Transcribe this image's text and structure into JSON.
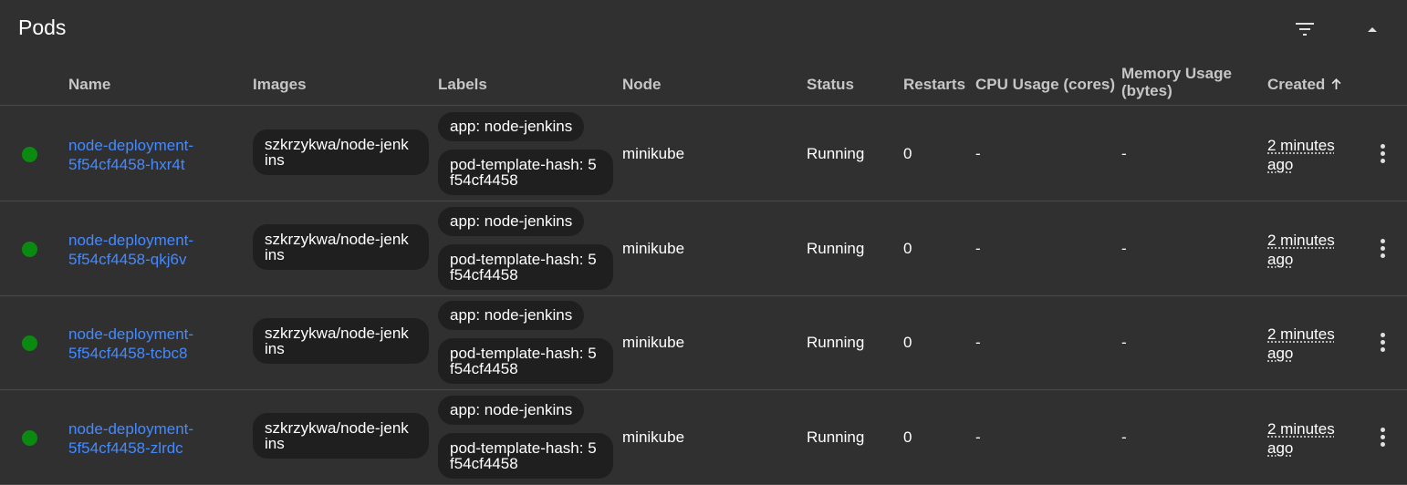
{
  "card": {
    "title": "Pods",
    "filter_icon": "filter-list-icon",
    "collapse_icon": "arrow-drop-up-icon"
  },
  "columns": {
    "name": "Name",
    "images": "Images",
    "labels": "Labels",
    "node": "Node",
    "status": "Status",
    "restarts": "Restarts",
    "cpu": "CPU Usage (cores)",
    "memory_line1": "Memory Usage",
    "memory_line2": "(bytes)",
    "created": "Created",
    "sort_icon": "arrow-upward-icon"
  },
  "colors": {
    "background": "#303030",
    "link": "#448aff",
    "status_running": "#0b8a12",
    "chip": "#1f1f1f"
  },
  "pods": [
    {
      "name_line1": "node-deployment-",
      "name_line2": "5f54cf4458-hxr4t",
      "image_line1": "szkrzykwa/node-jenk",
      "image_line2": "ins",
      "label_app": "app: node-jenkins",
      "label_hash_line1": "pod-template-hash: 5",
      "label_hash_line2": "f54cf4458",
      "node": "minikube",
      "status": "Running",
      "restarts": "0",
      "cpu": "-",
      "memory": "-",
      "created_line1": "2 minutes",
      "created_line2": "ago"
    },
    {
      "name_line1": "node-deployment-",
      "name_line2": "5f54cf4458-qkj6v",
      "image_line1": "szkrzykwa/node-jenk",
      "image_line2": "ins",
      "label_app": "app: node-jenkins",
      "label_hash_line1": "pod-template-hash: 5",
      "label_hash_line2": "f54cf4458",
      "node": "minikube",
      "status": "Running",
      "restarts": "0",
      "cpu": "-",
      "memory": "-",
      "created_line1": "2 minutes",
      "created_line2": "ago"
    },
    {
      "name_line1": "node-deployment-",
      "name_line2": "5f54cf4458-tcbc8",
      "image_line1": "szkrzykwa/node-jenk",
      "image_line2": "ins",
      "label_app": "app: node-jenkins",
      "label_hash_line1": "pod-template-hash: 5",
      "label_hash_line2": "f54cf4458",
      "node": "minikube",
      "status": "Running",
      "restarts": "0",
      "cpu": "-",
      "memory": "-",
      "created_line1": "2 minutes",
      "created_line2": "ago"
    },
    {
      "name_line1": "node-deployment-",
      "name_line2": "5f54cf4458-zlrdc",
      "image_line1": "szkrzykwa/node-jenk",
      "image_line2": "ins",
      "label_app": "app: node-jenkins",
      "label_hash_line1": "pod-template-hash: 5",
      "label_hash_line2": "f54cf4458",
      "node": "minikube",
      "status": "Running",
      "restarts": "0",
      "cpu": "-",
      "memory": "-",
      "created_line1": "2 minutes",
      "created_line2": "ago"
    }
  ]
}
